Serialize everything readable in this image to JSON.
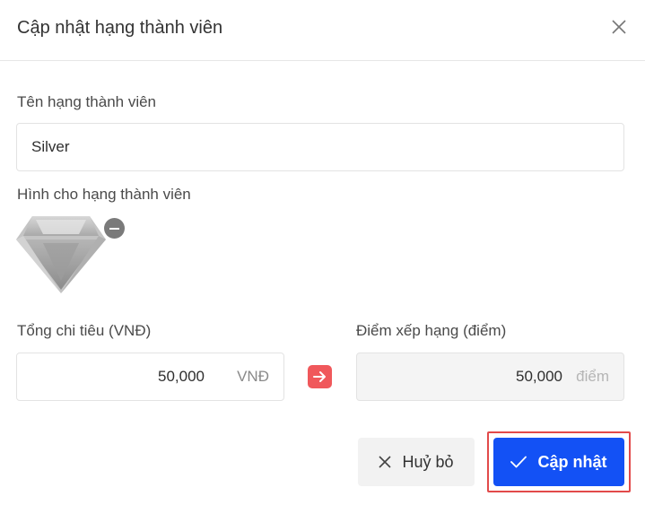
{
  "dialog": {
    "title": "Cập nhật hạng thành viên"
  },
  "form": {
    "tier_name_label": "Tên hạng thành viên",
    "tier_name_value": "Silver",
    "tier_image_label": "Hình cho hạng thành viên",
    "total_spend_label": "Tổng chi tiêu (VNĐ)",
    "total_spend_value": "50,000",
    "total_spend_unit": "VNĐ",
    "rank_points_label": "Điểm xếp hạng (điểm)",
    "rank_points_value": "50,000",
    "rank_points_unit": "điểm"
  },
  "actions": {
    "cancel_label": "Huỷ bỏ",
    "update_label": "Cập nhật"
  },
  "colors": {
    "primary": "#1351f5",
    "arrow_badge": "#f0585b",
    "highlight_border": "#e24a4a"
  }
}
